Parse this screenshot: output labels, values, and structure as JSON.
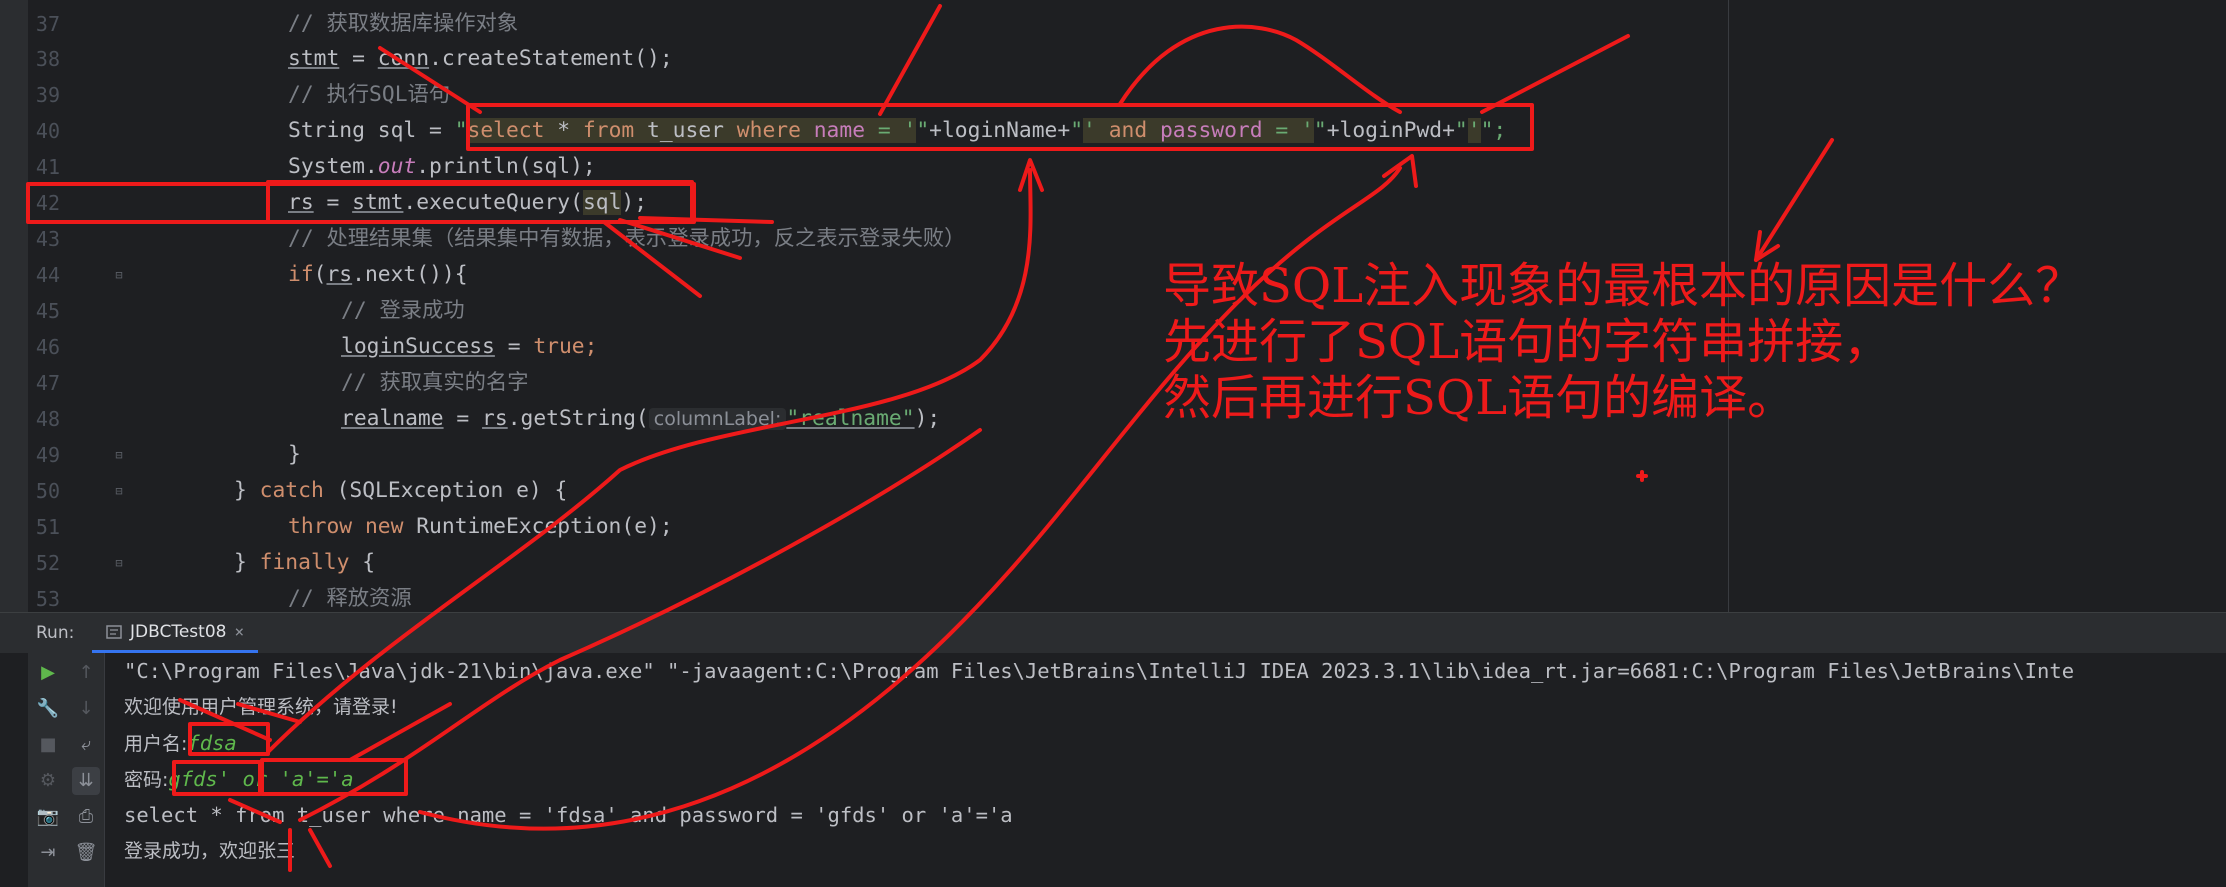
{
  "editor": {
    "lines": [
      {
        "num": "37"
      },
      {
        "num": "38"
      },
      {
        "num": "39"
      },
      {
        "num": "40"
      },
      {
        "num": "41"
      },
      {
        "num": "42"
      },
      {
        "num": "43"
      },
      {
        "num": "44"
      },
      {
        "num": "45"
      },
      {
        "num": "46"
      },
      {
        "num": "47"
      },
      {
        "num": "48"
      },
      {
        "num": "49"
      },
      {
        "num": "50"
      },
      {
        "num": "51"
      },
      {
        "num": "52"
      },
      {
        "num": "53"
      }
    ],
    "code": {
      "l37_comment": "// 获取数据库操作对象",
      "l38_var": "stmt",
      "l38_eq": " = ",
      "l38_obj": "conn",
      "l38_call": ".createStatement();",
      "l39_comment": "// 执行SQL语句",
      "l40_decl": "String sql = ",
      "l40_q1": "\"",
      "l40_s1_select": "select",
      "l40_s1_star": " * ",
      "l40_s1_from": "from",
      "l40_s1_table": " t_user ",
      "l40_s1_where": "where",
      "l40_s1_sp": " ",
      "l40_s1_name": "name",
      "l40_s1_eq": " = '",
      "l40_q2": "\"",
      "l40_concat1": "+loginName+",
      "l40_q3": "\"",
      "l40_s2_q": "' ",
      "l40_s2_and": "and",
      "l40_s2_sp": " ",
      "l40_s2_password": "password",
      "l40_s2_eq": " = '",
      "l40_q4": "\"",
      "l40_concat2": "+loginPwd+",
      "l40_q5": "\"",
      "l40_s3": "'",
      "l40_end": "\";",
      "l41_sys": "System.",
      "l41_out": "out",
      "l41_call": ".println(sql);",
      "l42_var": "rs",
      "l42_eq": " = ",
      "l42_obj": "stmt",
      "l42_call": ".executeQuery(",
      "l42_arg": "sql",
      "l42_end": ");",
      "l43_comment": "// 处理结果集（结果集中有数据，表示登录成功，反之表示登录失败）",
      "l44_if": "if",
      "l44_open": "(",
      "l44_var": "rs",
      "l44_call": ".next()){",
      "l45_comment": "// 登录成功",
      "l46_var": "loginSuccess",
      "l46_eq": " = ",
      "l46_true": "true",
      "l46_end": ";",
      "l47_comment": "// 获取真实的名字",
      "l48_var": "realname",
      "l48_eq": " = ",
      "l48_obj": "rs",
      "l48_call": ".getString(",
      "l48_hint": "columnLabel:",
      "l48_str": "\"realname\"",
      "l48_end": ");",
      "l49_close": "}",
      "l50_close": "} ",
      "l50_catch": "catch",
      "l50_rest": " (SQLException e) {",
      "l51_throw": "throw",
      "l51_sp": " ",
      "l51_new": "new",
      "l51_rest": " RuntimeException(e);",
      "l52_close": "} ",
      "l52_finally": "finally",
      "l52_rest": " {",
      "l53_comment": "// 释放资源"
    }
  },
  "run": {
    "label": "Run:",
    "tab_label": "JDBCTest08",
    "tab_close": "×",
    "console": {
      "cmd": "\"C:\\Program Files\\Java\\jdk-21\\bin\\java.exe\" \"-javaagent:C:\\Program Files\\JetBrains\\IntelliJ IDEA 2023.3.1\\lib\\idea_rt.jar=6681:C:\\Program Files\\JetBrains\\Inte",
      "welcome": "欢迎使用用户管理系统，请登录!",
      "user_prompt": "用户名:",
      "user_input": "fdsa",
      "pwd_prompt": "密码:",
      "pwd_input": "gfds' or 'a'='a",
      "sql_out": "select * from t_user where name = 'fdsa' and password = 'gfds' or 'a'='a",
      "result": "登录成功，欢迎张三"
    }
  },
  "annotation": {
    "line1": "导致SQL注入现象的最根本的原因是什么？",
    "line2": "先进行了SQL语句的字符串拼接，",
    "line3": "然后再进行SQL语句的编译。"
  },
  "colors": {
    "editor_bg": "#1e1f22",
    "keyword": "#cf8e6d",
    "comment": "#7a7e85",
    "string": "#6aab73",
    "field": "#c77dbb",
    "annotation_red": "#ee1a1a"
  }
}
